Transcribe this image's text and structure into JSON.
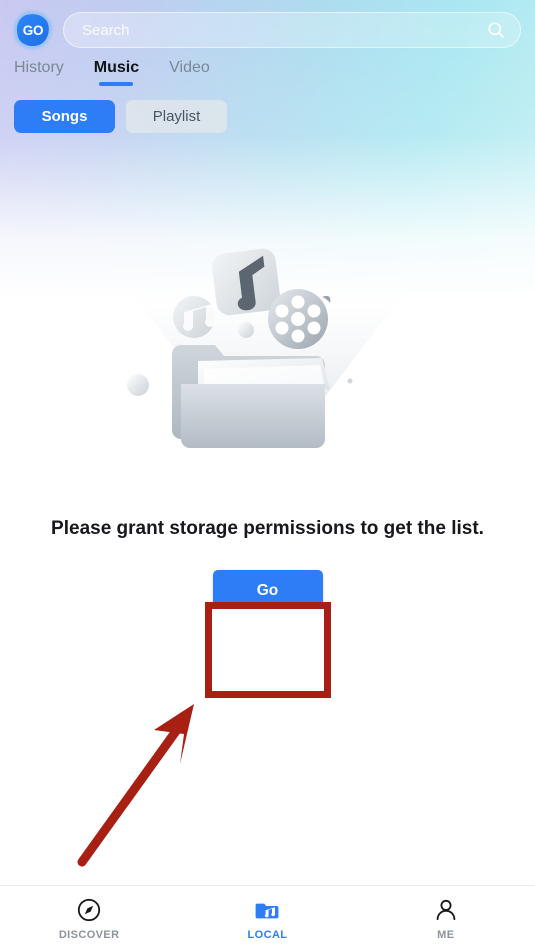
{
  "app": {
    "logo_text": "GO",
    "accent_color": "#2d7df6",
    "annotation_color": "#a81f14"
  },
  "search": {
    "placeholder": "Search",
    "value": "",
    "icon": "search-icon"
  },
  "tabs": [
    {
      "label": "History",
      "active": false
    },
    {
      "label": "Music",
      "active": true
    },
    {
      "label": "Video",
      "active": false
    }
  ],
  "segmented": [
    {
      "label": "Songs",
      "selected": true
    },
    {
      "label": "Playlist",
      "selected": false
    }
  ],
  "empty_state": {
    "message": "Please grant storage permissions to get the list.",
    "action_label": "Go",
    "illustration": "empty-folder-media-illustration"
  },
  "bottom_nav": [
    {
      "label": "DISCOVER",
      "icon": "compass-icon",
      "active": false
    },
    {
      "label": "LOCAL",
      "icon": "music-folder-icon",
      "active": true
    },
    {
      "label": "ME",
      "icon": "person-icon",
      "active": false
    }
  ]
}
